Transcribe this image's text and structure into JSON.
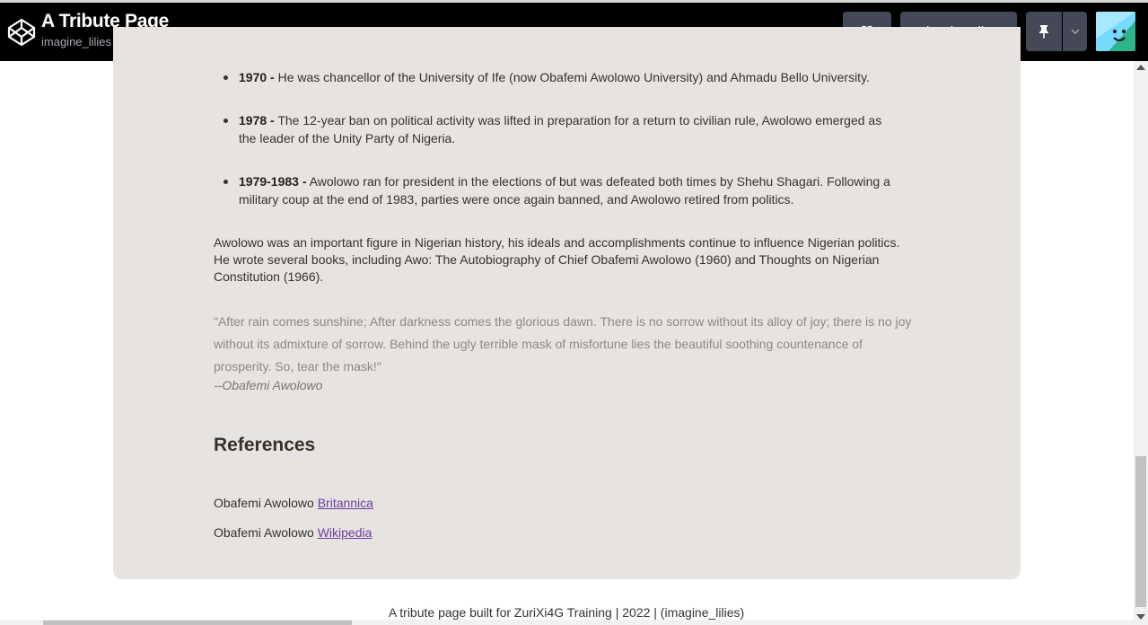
{
  "header": {
    "title": "A Tribute Page",
    "author": "imagine_lilies",
    "view_in_editor_label": "View in Editor",
    "logo_icon": "codepen-logo-icon",
    "heart_icon": "heart-icon",
    "pin_icon": "pin-icon",
    "caret_icon": "chevron-down-icon"
  },
  "timeline": [
    {
      "year": "1970 -",
      "text": "He was chancellor of the University of Ife (now Obafemi Awolowo University) and Ahmadu Bello University."
    },
    {
      "year": "1978 -",
      "text": "The 12-year ban on political activity was lifted in preparation for a return to civilian rule, Awolowo emerged as the leader of the Unity Party of Nigeria."
    },
    {
      "year": "1979-1983 -",
      "text": "Awolowo ran for president in the elections of but was defeated both times by Shehu Shagari. Following a military coup at the end of 1983, parties were once again banned, and Awolowo retired from politics."
    }
  ],
  "summary": "Awolowo was an important figure in Nigerian history, his ideals and accomplishments continue to influence Nigerian politics. He wrote several books, including Awo: The Autobiography of Chief Obafemi Awolowo (1960) and Thoughts on Nigerian Constitution (1966).",
  "quote": {
    "text": "\"After rain comes sunshine; After darkness comes the glorious dawn. There is no sorrow without its alloy of joy; there is no joy without its admixture of sorrow. Behind the ugly terrible mask of misfortune lies the beautiful soothing countenance of prosperity. So, tear the mask!\"",
    "author": "--Obafemi Awolowo"
  },
  "references": {
    "heading": "References",
    "items": [
      {
        "prefix": "Obafemi Awolowo",
        "link": "Britannica"
      },
      {
        "prefix": "Obafemi Awolowo",
        "link": "Wikipedia"
      }
    ]
  },
  "footer": "A tribute page built for ZuriXi4G Training | 2022 | (imagine_lilies)",
  "colors": {
    "header_bg": "#000000",
    "button_bg": "#444857",
    "card_bg": "#e7e3e0",
    "link": "#6b3fa0"
  }
}
